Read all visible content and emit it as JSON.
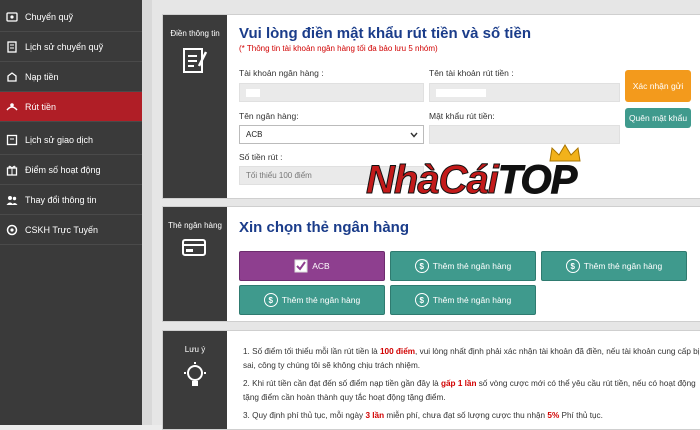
{
  "sidebar": {
    "items": [
      {
        "label": "Chuyển quỹ",
        "icon": "transfer-icon"
      },
      {
        "label": "Lịch sử chuyển quỹ",
        "icon": "history-icon"
      },
      {
        "label": "Nạp tiền",
        "icon": "deposit-icon"
      },
      {
        "label": "Rút tiền",
        "icon": "withdraw-icon"
      },
      {
        "label": "Lịch sử giao dịch",
        "icon": "transaction-history-icon"
      },
      {
        "label": "Điểm số hoạt động",
        "icon": "gift-icon"
      },
      {
        "label": "Thay đổi thông tin",
        "icon": "users-icon"
      },
      {
        "label": "CSKH Trực Tuyến",
        "icon": "support-icon"
      }
    ],
    "active_index": 3
  },
  "info": {
    "side_label": "Điền thông tin",
    "title": "Vui lòng điền mật khẩu rút tiền và số tiền",
    "note": "(* Thông tin tài khoản ngân hàng tối đa bảo lưu 5 nhóm)",
    "account_label": "Tài khoản ngân hàng :",
    "account_name_label": "Tên tài khoản rút tiền :",
    "bank_name_label": "Tên ngân hàng:",
    "bank_selected": "ACB",
    "password_label": "Mật khẩu rút tiền:",
    "amount_label": "Số tiền rút :",
    "amount_placeholder": "Tối thiểu 100 điểm",
    "confirm_button": "Xác nhận gửi",
    "forgot_button": "Quên mật khẩu"
  },
  "banks": {
    "side_label": "Thẻ ngân hàng",
    "title": "Xin chọn thẻ ngân hàng",
    "selected": "ACB",
    "add_label": "Thêm thẻ ngân hàng"
  },
  "notes": {
    "side_label": "Lưu ý",
    "rule1_a": "1. Số điểm tối thiểu mỗi lần rút tiền là ",
    "rule1_b": "100 điểm",
    "rule1_c": ", vui lòng nhất định phải xác nhận tài khoản đã điền, nếu tài khoản cung cấp bị sai, công ty chúng tôi sẽ không chịu trách nhiệm.",
    "rule2_a": "2. Khi rút tiền cần đạt đến số điểm nạp tiền gần đây là ",
    "rule2_b": "gấp 1 lần",
    "rule2_c": " số vòng cược mới có thể yêu cầu rút tiền, nếu có hoạt động tặng điểm cần hoàn thành quy tắc hoạt động tặng điểm.",
    "rule3_a": "3. Quy định phí thủ tục, mỗi ngày ",
    "rule3_b": "3 lần",
    "rule3_c": " miễn phí, chưa đạt số lượng cược thu nhận ",
    "rule3_d": "5%",
    "rule3_e": " Phí thủ tục."
  },
  "watermark": {
    "part1": "NhàCái",
    "part2": "TOP"
  },
  "colors": {
    "active": "#b01e26",
    "teal": "#3f9a8d",
    "purple": "#8e3f8f",
    "orange": "#f39a1c",
    "title": "#1a3c8a"
  }
}
